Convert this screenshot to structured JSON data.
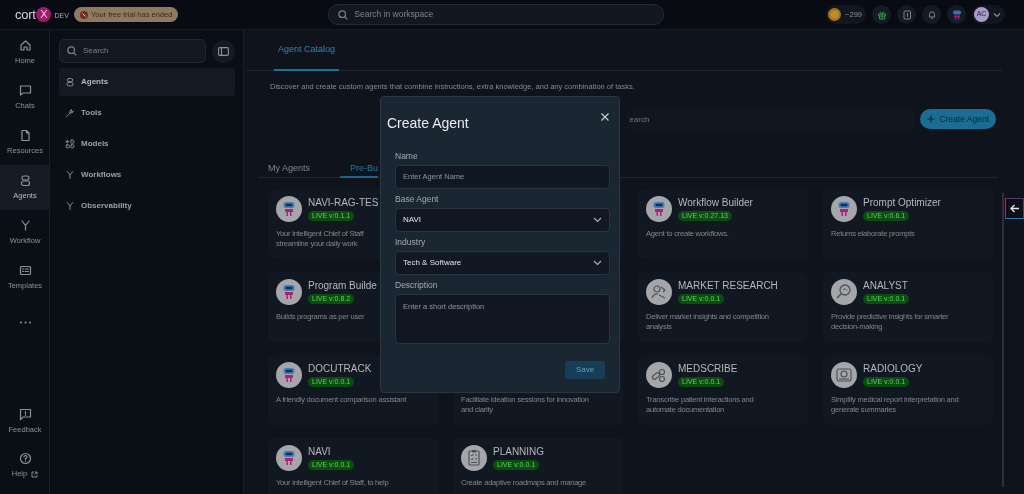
{
  "topbar": {
    "logo_text": "cort",
    "logo_mark": "X",
    "env": "DEV",
    "trial_notice": "Your free trial has ended",
    "search_placeholder": "Search in workspace",
    "credits": "~299",
    "avatar": "AC"
  },
  "rail": {
    "items": [
      {
        "label": "Home",
        "kind": "home",
        "selected": false
      },
      {
        "label": "Chats",
        "kind": "chat",
        "selected": false
      },
      {
        "label": "Resources",
        "kind": "file",
        "selected": false
      },
      {
        "label": "Agents",
        "kind": "agents",
        "selected": true
      },
      {
        "label": "Workflow",
        "kind": "workflow",
        "selected": false
      },
      {
        "label": "Templates",
        "kind": "templates",
        "selected": false
      },
      {
        "kind": "more",
        "selected": false
      }
    ],
    "bottom_items": [
      {
        "label": "Feedback",
        "kind": "feedback"
      },
      {
        "label": "Help",
        "kind": "help"
      }
    ]
  },
  "sidebar": {
    "search_placeholder": "Search",
    "items": [
      {
        "label": "Agents",
        "kind": "agents",
        "selected": true
      },
      {
        "label": "Tools",
        "kind": "tools",
        "selected": false
      },
      {
        "label": "Models",
        "kind": "models",
        "selected": false
      },
      {
        "label": "Workflows",
        "kind": "workflow",
        "selected": false
      },
      {
        "label": "Observability",
        "kind": "workflow",
        "selected": false
      }
    ]
  },
  "main": {
    "tabs": [
      {
        "label": "Agent Catalog",
        "selected": true
      }
    ],
    "description": "Discover and create custom agents that combine instructions, extra knowledge, and any combination of tasks.",
    "search_placeholder": "earch",
    "create_button": "Create Agent",
    "agent_tabs": [
      {
        "label": "My Agents",
        "selected": false
      },
      {
        "label": "Pre-Bu",
        "selected": true
      }
    ],
    "card_rows": [
      [
        {
          "kind": "robot",
          "title": "NAVI-RAG-TES",
          "version": "LIVE v:0.1.1",
          "description_lines": [
            "Your intelligent Chief of Staff",
            "streamline your daily work"
          ]
        },
        null,
        {
          "kind": "robot",
          "title": "Workflow Builder",
          "version": "LIVE v:0.27.13",
          "description_lines": [
            "Agent to create workflows."
          ]
        },
        {
          "kind": "robot",
          "title": "Prompt Optimizer",
          "version": "LIVE v:0.6.1",
          "description_lines": [
            "Returns elaborate prompts"
          ]
        }
      ],
      [
        {
          "kind": "robot",
          "title": "Program Builde",
          "version": "LIVE v:0.8.2",
          "description_lines": [
            "Builds programs as per user"
          ]
        },
        null,
        {
          "kind": "research",
          "title": "MARKET RESEARCH",
          "version": "LIVE v:0.0.1",
          "description_lines": [
            "Deliver market insights and competition",
            "analysis"
          ]
        },
        {
          "kind": "analyst",
          "title": "ANALYST",
          "version": "LIVE v:0.0.1",
          "description_lines": [
            "Provide predictive insights for smarter",
            "decision-making"
          ]
        }
      ],
      [
        {
          "kind": "robot",
          "title": "DOCUTRACK",
          "version": "LIVE v:0.0.1",
          "description_lines": [
            "A friendly document comparison assistant"
          ]
        },
        {
          "description_lines": [
            "Facilitate ideation sessions for innovation",
            "and clarity"
          ]
        },
        {
          "kind": "pills",
          "title": "MEDSCRIBE",
          "version": "LIVE v:0.0.1",
          "description_lines": [
            "Transcribe patient interactions and",
            "automate documentation"
          ]
        },
        {
          "kind": "scan",
          "title": "RADIOLOGY",
          "version": "LIVE v:0.0.1",
          "description_lines": [
            "Simplify medical report interpretation and",
            "generate summaries"
          ]
        }
      ],
      [
        {
          "kind": "robot",
          "title": "NAVI",
          "version": "LIVE v:0.0.1",
          "description_lines": [
            "Your intelligent Chief of Staff, to help"
          ]
        },
        {
          "kind": "clipboard",
          "title": "PLANNING",
          "version": "LIVE v:0.0.1",
          "description_lines": [
            "Create adaptive roadmaps and manage"
          ]
        }
      ]
    ]
  },
  "modal": {
    "title": "Create Agent",
    "fields": [
      {
        "label": "Name",
        "kind": "input",
        "placeholder": "Enter Agent Name"
      },
      {
        "label": "Base Agent",
        "kind": "select",
        "value": "NAVI"
      },
      {
        "label": "Industry",
        "kind": "select",
        "value": "Tech & Software"
      },
      {
        "label": "Description",
        "kind": "textarea",
        "placeholder": "Enter a short description"
      }
    ],
    "save_button": {
      "label": "Save",
      "disabled": true
    }
  }
}
